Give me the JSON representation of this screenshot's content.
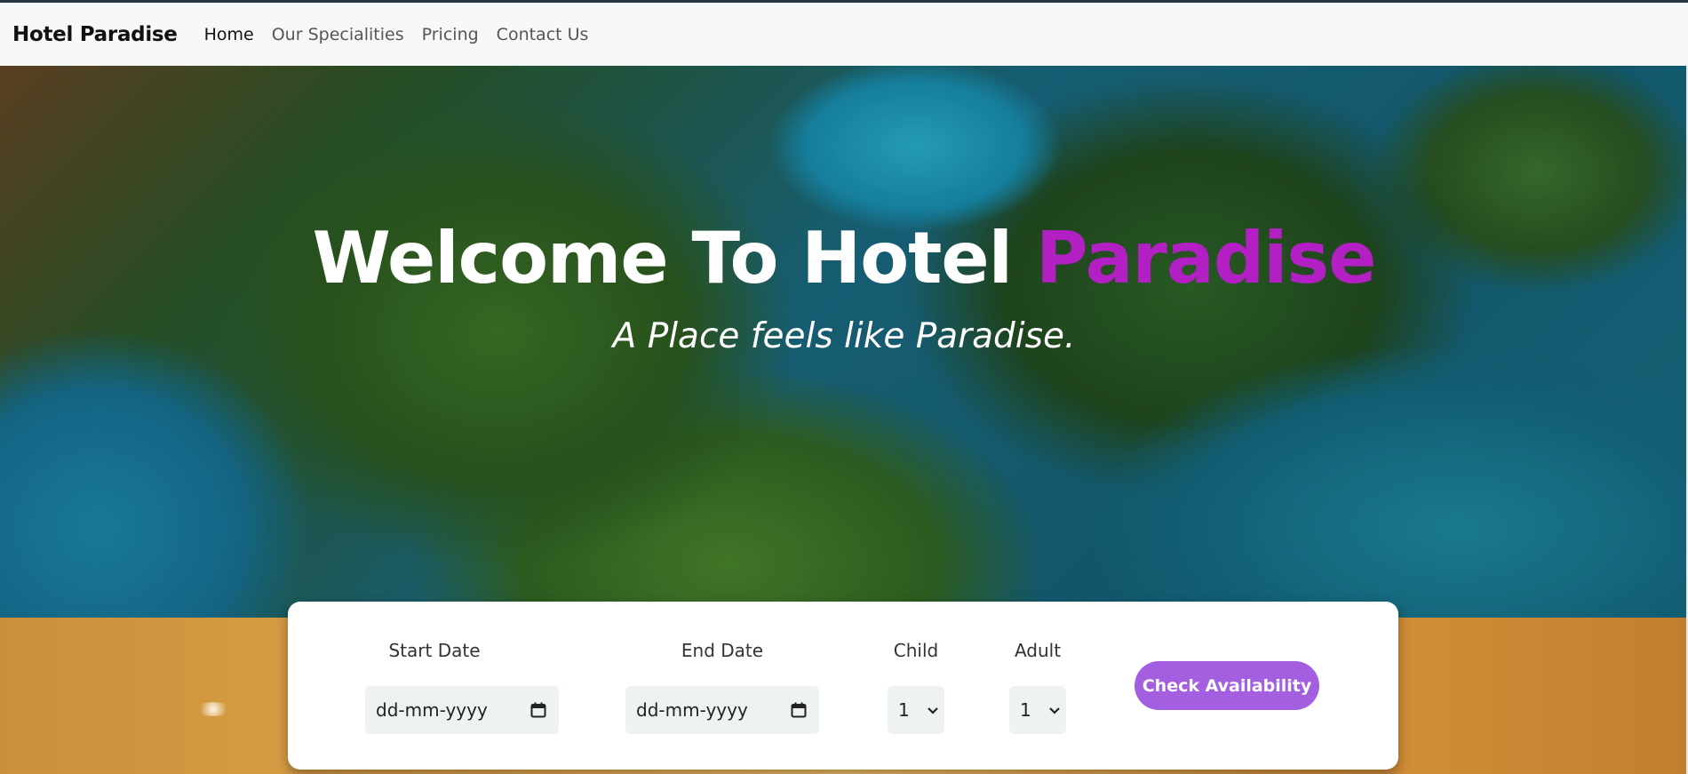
{
  "navbar": {
    "brand": "Hotel Paradise",
    "links": [
      {
        "label": "Home",
        "active": true
      },
      {
        "label": "Our Specialities",
        "active": false
      },
      {
        "label": "Pricing",
        "active": false
      },
      {
        "label": "Contact Us",
        "active": false
      }
    ]
  },
  "hero": {
    "title_main": "Welcome To Hotel",
    "title_accent": "Paradise",
    "subtitle": "A Place feels like Paradise."
  },
  "booking": {
    "start_date": {
      "label": "Start Date",
      "value": "dd-mm-yyyy"
    },
    "end_date": {
      "label": "End Date",
      "value": "dd-mm-yyyy"
    },
    "child": {
      "label": "Child",
      "value": "1"
    },
    "adult": {
      "label": "Adult",
      "value": "1"
    },
    "check_button": "Check Availability"
  },
  "colors": {
    "accent": "#b21fc2",
    "button": "#a35fe0"
  }
}
